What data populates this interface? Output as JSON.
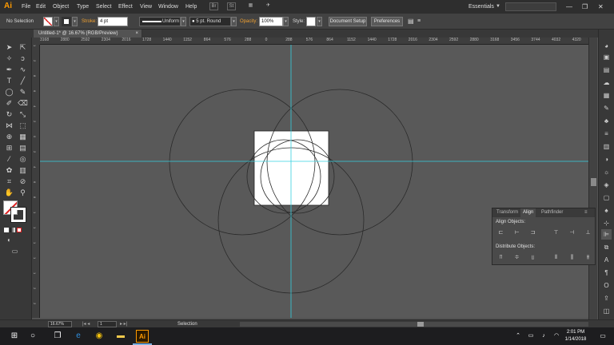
{
  "menubar": {
    "logo": "Ai",
    "items": [
      "File",
      "Edit",
      "Object",
      "Type",
      "Select",
      "Effect",
      "View",
      "Window",
      "Help"
    ],
    "workspace": "Essentials",
    "window_buttons": [
      "—",
      "❐",
      "✕"
    ]
  },
  "control_bar": {
    "selection_label": "No Selection",
    "stroke_label": "Stroke:",
    "stroke_value": "4 pt",
    "profile_value": "Uniform",
    "brush_value": "5 pt. Round",
    "opacity_label": "Opacity:",
    "opacity_value": "100%",
    "style_label": "Style:",
    "document_setup": "Document Setup",
    "preferences": "Preferences"
  },
  "document": {
    "tab_title": "Untitled-1* @ 16.67% (RGB/Preview)",
    "close_icon": "×"
  },
  "rulers": {
    "h_ticks": [
      "3168",
      "2880",
      "2592",
      "2304",
      "2016",
      "1728",
      "1440",
      "1152",
      "864",
      "576",
      "288",
      "0",
      "288",
      "576",
      "864",
      "1152",
      "1440",
      "1728",
      "2016",
      "2304",
      "2592",
      "2880",
      "3168",
      "3456",
      "3744",
      "4032",
      "4320"
    ],
    "v_ticks": [
      "1",
      "2",
      "8",
      "6",
      "4",
      "2",
      "0",
      "2",
      "4",
      "6",
      "8",
      "1",
      "1",
      "1",
      "1",
      "1",
      "2",
      "2"
    ]
  },
  "align_panel": {
    "tabs": [
      "Transform",
      "Align",
      "Pathfinder"
    ],
    "align_objects": "Align Objects:",
    "distribute_objects": "Distribute Objects:"
  },
  "status_bar": {
    "zoom": "16.67%",
    "page": "1",
    "tool": "Selection"
  },
  "taskbar": {
    "time": "2:01 PM",
    "date": "1/14/2018",
    "app_label": "Ai"
  },
  "colors": {
    "guide": "#35d0e0",
    "artboard": "#ffffff",
    "canvas": "#595959",
    "illustrator_orange": "#ff9a00"
  }
}
